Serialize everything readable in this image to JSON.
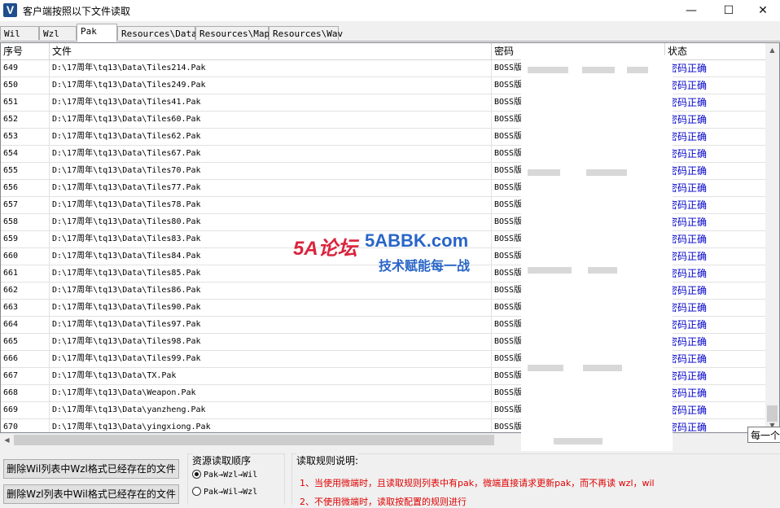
{
  "window": {
    "title": "客户端按照以下文件读取",
    "icon_letter": "V",
    "minimize": "—",
    "maximize": "☐",
    "close": "✕"
  },
  "tabs": [
    {
      "label": "Wil"
    },
    {
      "label": "Wzl"
    },
    {
      "label": "Pak"
    },
    {
      "label": "Resources\\Data"
    },
    {
      "label": "Resources\\Map"
    },
    {
      "label": "Resources\\Wav"
    }
  ],
  "active_tab": "Pak",
  "table": {
    "columns": [
      "序号",
      "文件",
      "密码",
      "状态"
    ],
    "rows": [
      {
        "id": "649",
        "file": "D:\\17周年\\tq13\\Data\\Tiles214.Pak",
        "pwd": "BOSS版",
        "status": "密码正确"
      },
      {
        "id": "650",
        "file": "D:\\17周年\\tq13\\Data\\Tiles249.Pak",
        "pwd": "BOSS版",
        "status": "密码正确"
      },
      {
        "id": "651",
        "file": "D:\\17周年\\tq13\\Data\\Tiles41.Pak",
        "pwd": "BOSS版",
        "status": "密码正确"
      },
      {
        "id": "652",
        "file": "D:\\17周年\\tq13\\Data\\Tiles60.Pak",
        "pwd": "BOSS版",
        "status": "密码正确"
      },
      {
        "id": "653",
        "file": "D:\\17周年\\tq13\\Data\\Tiles62.Pak",
        "pwd": "BOSS版",
        "status": "密码正确"
      },
      {
        "id": "654",
        "file": "D:\\17周年\\tq13\\Data\\Tiles67.Pak",
        "pwd": "BOSS版",
        "status": "密码正确"
      },
      {
        "id": "655",
        "file": "D:\\17周年\\tq13\\Data\\Tiles70.Pak",
        "pwd": "BOSS版",
        "status": "密码正确"
      },
      {
        "id": "656",
        "file": "D:\\17周年\\tq13\\Data\\Tiles77.Pak",
        "pwd": "BOSS版",
        "status": "密码正确"
      },
      {
        "id": "657",
        "file": "D:\\17周年\\tq13\\Data\\Tiles78.Pak",
        "pwd": "BOSS版",
        "status": "密码正确"
      },
      {
        "id": "658",
        "file": "D:\\17周年\\tq13\\Data\\Tiles80.Pak",
        "pwd": "BOSS版",
        "status": "密码正确"
      },
      {
        "id": "659",
        "file": "D:\\17周年\\tq13\\Data\\Tiles83.Pak",
        "pwd": "BOSS版",
        "status": "密码正确"
      },
      {
        "id": "660",
        "file": "D:\\17周年\\tq13\\Data\\Tiles84.Pak",
        "pwd": "BOSS版",
        "status": "密码正确"
      },
      {
        "id": "661",
        "file": "D:\\17周年\\tq13\\Data\\Tiles85.Pak",
        "pwd": "BOSS版",
        "status": "密码正确"
      },
      {
        "id": "662",
        "file": "D:\\17周年\\tq13\\Data\\Tiles86.Pak",
        "pwd": "BOSS版",
        "status": "密码正确"
      },
      {
        "id": "663",
        "file": "D:\\17周年\\tq13\\Data\\Tiles90.Pak",
        "pwd": "BOSS版",
        "status": "密码正确"
      },
      {
        "id": "664",
        "file": "D:\\17周年\\tq13\\Data\\Tiles97.Pak",
        "pwd": "BOSS版",
        "status": "密码正确"
      },
      {
        "id": "665",
        "file": "D:\\17周年\\tq13\\Data\\Tiles98.Pak",
        "pwd": "BOSS版",
        "status": "密码正确"
      },
      {
        "id": "666",
        "file": "D:\\17周年\\tq13\\Data\\Tiles99.Pak",
        "pwd": "BOSS版",
        "status": "密码正确"
      },
      {
        "id": "667",
        "file": "D:\\17周年\\tq13\\Data\\TX.Pak",
        "pwd": "BOSS版",
        "status": "密码正确"
      },
      {
        "id": "668",
        "file": "D:\\17周年\\tq13\\Data\\Weapon.Pak",
        "pwd": "BOSS版",
        "status": "密码正确"
      },
      {
        "id": "669",
        "file": "D:\\17周年\\tq13\\Data\\yanzheng.Pak",
        "pwd": "BOSS版",
        "status": "密码正确"
      },
      {
        "id": "670",
        "file": "D:\\17周年\\tq13\\Data\\yingxiong.Pak",
        "pwd": "BOSS版",
        "status": "密码正确"
      }
    ]
  },
  "tooltip": "每一个",
  "buttons": {
    "delete_wil": "删除Wil列表中Wzl格式已经存在的文件",
    "delete_wzl": "删除Wzl列表中Wil格式已经存在的文件"
  },
  "resource_order": {
    "title": "资源读取顺序",
    "options": [
      "Pak→Wzl→Wil",
      "Pak→Wil→Wzl"
    ],
    "selected": 0
  },
  "rules": {
    "title": "读取规则说明:",
    "items": [
      "1、当使用微端时，且读取规则列表中有pak，微端直接请求更新pak，而不再读 wzl，wil",
      "2、不使用微端时，读取按配置的规则进行"
    ]
  },
  "watermark": {
    "logo": "5A论坛",
    "site": "5ABBK.com",
    "slogan": "技术赋能每一战"
  }
}
